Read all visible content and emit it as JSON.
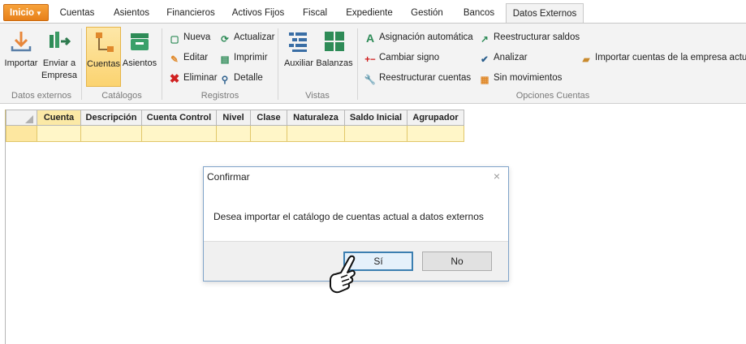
{
  "tabs": [
    {
      "label": "Inicio"
    },
    {
      "label": "Cuentas"
    },
    {
      "label": "Asientos"
    },
    {
      "label": "Financieros"
    },
    {
      "label": "Activos Fijos"
    },
    {
      "label": "Fiscal"
    },
    {
      "label": "Expediente"
    },
    {
      "label": "Gestión"
    },
    {
      "label": "Bancos"
    },
    {
      "label": "Datos Externos"
    }
  ],
  "ribbon": {
    "groups": {
      "datos_externos": "Datos externos",
      "catalogos": "Catálogos",
      "registros": "Registros",
      "vistas": "Vistas",
      "opciones": "Opciones Cuentas"
    },
    "importar": "Importar",
    "enviar_1": "Enviar a",
    "enviar_2": "Empresa",
    "cuentas": "Cuentas",
    "asientos": "Asientos",
    "nueva": "Nueva",
    "editar": "Editar",
    "eliminar": "Eliminar",
    "actualizar": "Actualizar",
    "imprimir": "Imprimir",
    "detalle": "Detalle",
    "auxiliar": "Auxiliar",
    "balanzas": "Balanzas",
    "asignacion": "Asignación automática",
    "cambiar_signo": "Cambiar signo",
    "reestructurar_cuentas": "Reestructurar cuentas",
    "reestructurar_saldos": "Reestructurar saldos",
    "analizar": "Analizar",
    "sin_movimientos": "Sin movimientos",
    "importar_cuentas": "Importar cuentas de la empresa actual"
  },
  "grid": {
    "columns": [
      "Cuenta",
      "Descripción",
      "Cuenta Control",
      "Nivel",
      "Clase",
      "Naturaleza",
      "Saldo Inicial",
      "Agrupador"
    ]
  },
  "dialog": {
    "title": "Confirmar",
    "close": "×",
    "message": "Desea importar el catálogo de cuentas actual a datos externos",
    "yes": "Sí",
    "no": "No"
  },
  "colors": {
    "accent_orange": "#e7801a",
    "selection_yellow": "#fbd370",
    "dialog_border": "#7fa3c9"
  }
}
